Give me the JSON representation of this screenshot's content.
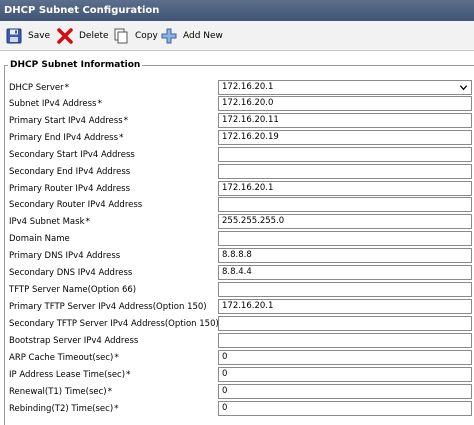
{
  "window": {
    "title": "DHCP Subnet Configuration"
  },
  "toolbar": {
    "save_label": "Save",
    "delete_label": "Delete",
    "copy_label": "Copy",
    "add_new_label": "Add New"
  },
  "section": {
    "title": "DHCP Subnet Information"
  },
  "fields": [
    {
      "label": "DHCP Server",
      "required": "*",
      "value": "172.16.20.1"
    },
    {
      "label": "Subnet IPv4 Address",
      "required": "*",
      "value": "172.16.20.0"
    },
    {
      "label": "Primary Start IPv4 Address",
      "required": "*",
      "value": "172.16.20.11"
    },
    {
      "label": "Primary End IPv4 Address",
      "required": "*",
      "value": "172.16.20.19"
    },
    {
      "label": "Secondary Start IPv4 Address",
      "required": "",
      "value": ""
    },
    {
      "label": "Secondary End IPv4 Address",
      "required": "",
      "value": ""
    },
    {
      "label": "Primary Router IPv4 Address",
      "required": "",
      "value": "172.16.20.1"
    },
    {
      "label": "Secondary Router IPv4 Address",
      "required": "",
      "value": ""
    },
    {
      "label": "IPv4 Subnet Mask",
      "required": "*",
      "value": "255.255.255.0"
    },
    {
      "label": "Domain Name",
      "required": "",
      "value": ""
    },
    {
      "label": "Primary DNS IPv4 Address",
      "required": "",
      "value": "8.8.8.8"
    },
    {
      "label": "Secondary DNS IPv4 Address",
      "required": "",
      "value": "8.8.4.4"
    },
    {
      "label": "TFTP Server Name(Option 66)",
      "required": "",
      "value": ""
    },
    {
      "label": "Primary TFTP Server IPv4 Address(Option 150)",
      "required": "",
      "value": "172.16.20.1"
    },
    {
      "label": "Secondary TFTP Server IPv4 Address(Option 150)",
      "required": "",
      "value": ""
    },
    {
      "label": "Bootstrap Server IPv4 Address",
      "required": "",
      "value": ""
    },
    {
      "label": "ARP Cache Timeout(sec)",
      "required": "*",
      "value": "0"
    },
    {
      "label": "IP Address Lease Time(sec)",
      "required": "*",
      "value": "0"
    },
    {
      "label": "Renewal(T1) Time(sec)",
      "required": "*",
      "value": "0"
    },
    {
      "label": "Rebinding(T2) Time(sec)",
      "required": "*",
      "value": "0"
    }
  ]
}
